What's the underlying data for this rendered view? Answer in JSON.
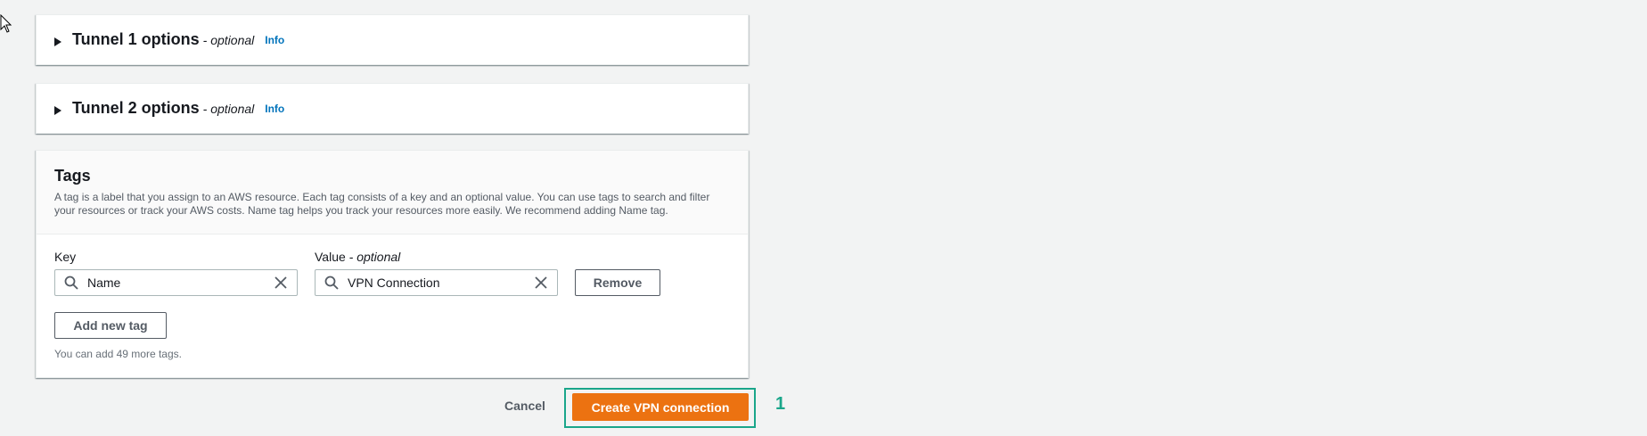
{
  "tunnel1": {
    "title": "Tunnel 1 options",
    "optional": "- optional",
    "info": "Info"
  },
  "tunnel2": {
    "title": "Tunnel 2 options",
    "optional": "- optional",
    "info": "Info"
  },
  "tags": {
    "title": "Tags",
    "description": "A tag is a label that you assign to an AWS resource. Each tag consists of a key and an optional value. You can use tags to search and filter your resources or track your AWS costs. Name tag helps you track your resources more easily. We recommend adding Name tag.",
    "key_label": "Key",
    "value_label": "Value",
    "value_optional": "- optional",
    "key_value": "Name",
    "value_value": "VPN Connection",
    "remove_label": "Remove",
    "add_label": "Add new tag",
    "hint": "You can add 49 more tags."
  },
  "footer": {
    "cancel_label": "Cancel",
    "create_label": "Create VPN connection",
    "step_marker": "1"
  },
  "colors": {
    "primary": "#ec7211",
    "link": "#0073bb",
    "highlight": "#1aa68a"
  },
  "icons": [
    "cursor-icon",
    "caret-right-icon",
    "search-icon",
    "clear-icon"
  ]
}
